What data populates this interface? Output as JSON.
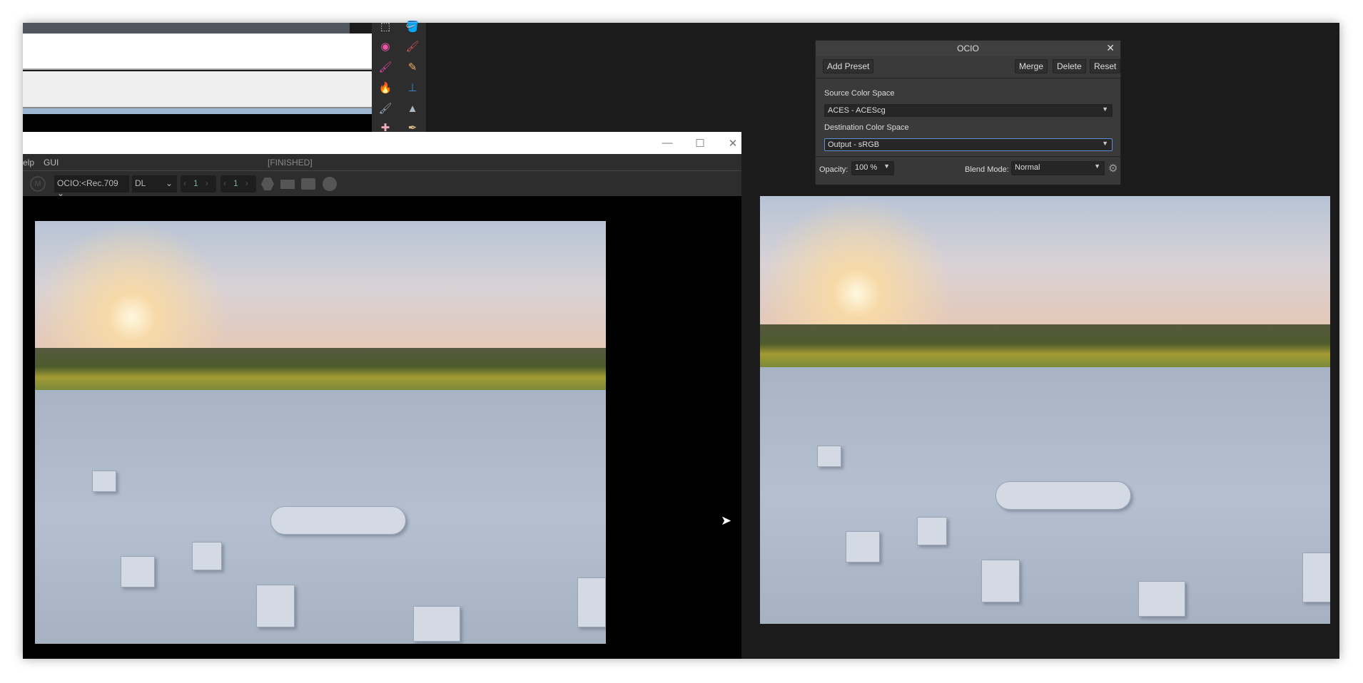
{
  "top_window": {},
  "tools": {
    "items": [
      "marquee-tool",
      "fill-tool",
      "color-wheel-tool",
      "paint-brush-tool",
      "mixer-brush-tool",
      "eraser-tool",
      "burn-tool",
      "clone-stamp-tool",
      "smudge-tool",
      "sharpen-tool",
      "patch-tool",
      "pen-tool"
    ]
  },
  "viewer": {
    "menu": {
      "help": "elp",
      "gui": "GUI",
      "status": "[FINISHED]"
    },
    "toolbar": {
      "ocio_select": "OCIO:<Rec.709",
      "layer_select": "DL",
      "frame_a": "1",
      "frame_b": "1"
    }
  },
  "ocio_panel": {
    "title": "OCIO",
    "add_preset": "Add Preset",
    "merge": "Merge",
    "delete": "Delete",
    "reset": "Reset",
    "source_label": "Source Color Space",
    "source_value": "ACES - ACEScg",
    "dest_label": "Destination Color Space",
    "dest_value": "Output - sRGB",
    "opacity_label": "Opacity:",
    "opacity_value": "100 %",
    "blend_label": "Blend Mode:",
    "blend_value": "Normal"
  }
}
